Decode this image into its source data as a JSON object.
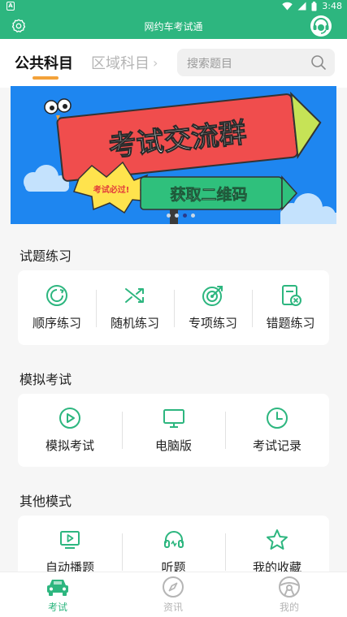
{
  "status_bar": {
    "time": "3:48",
    "app_icon_letter": "A"
  },
  "title_bar": {
    "title": "网约车考试通",
    "settings_icon": "gear-icon",
    "service_icon": "headset-icon"
  },
  "subject_tabs": {
    "active": "公共科目",
    "inactive": "区域科目",
    "inactive_chevron": "›"
  },
  "search": {
    "placeholder": "搜索题目"
  },
  "banner": {
    "headline": "考试交流群",
    "badge": "考试必过!",
    "cta": "获取二维码",
    "slide_count": 4,
    "active_slide": 3
  },
  "sections": [
    {
      "title": "试题练习",
      "items": [
        {
          "label": "顺序练习",
          "icon": "sequence-icon"
        },
        {
          "label": "随机练习",
          "icon": "shuffle-icon"
        },
        {
          "label": "专项练习",
          "icon": "target-icon"
        },
        {
          "label": "错题练习",
          "icon": "wrong-answers-icon"
        }
      ]
    },
    {
      "title": "模拟考试",
      "items": [
        {
          "label": "模拟考试",
          "icon": "play-icon"
        },
        {
          "label": "电脑版",
          "icon": "monitor-icon"
        },
        {
          "label": "考试记录",
          "icon": "clock-icon"
        }
      ]
    },
    {
      "title": "其他模式",
      "items": [
        {
          "label": "自动播题",
          "icon": "video-play-icon"
        },
        {
          "label": "听题",
          "icon": "headphones-icon"
        },
        {
          "label": "我的收藏",
          "icon": "star-icon"
        }
      ]
    }
  ],
  "bottom_nav": [
    {
      "label": "考试",
      "icon": "car-icon",
      "active": true
    },
    {
      "label": "资讯",
      "icon": "compass-icon",
      "active": false
    },
    {
      "label": "我的",
      "icon": "steering-wheel-icon",
      "active": false
    }
  ],
  "colors": {
    "brand_green": "#2db67f",
    "accent_orange": "#f3a23a",
    "inactive_gray": "#b5b5b5",
    "banner_blue": "#1e86f0"
  }
}
